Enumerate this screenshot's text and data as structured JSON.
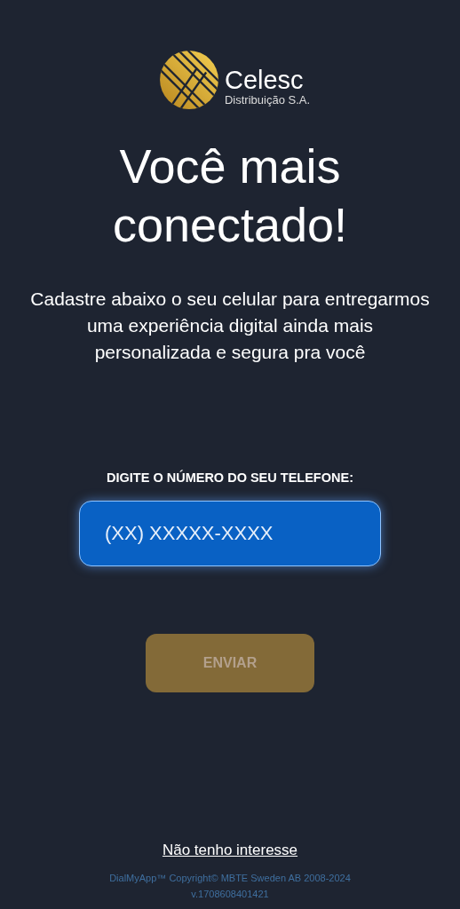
{
  "logo": {
    "name": "Celesc",
    "subtitle": "Distribuição S.A."
  },
  "title": "Você mais conectado!",
  "description": "Cadastre abaixo o seu celular para entregarmos uma experiência digital ainda mais personalizada e segura pra você",
  "phone_field": {
    "label": "DIGITE O NÚMERO DO SEU TELEFONE:",
    "placeholder": "(XX) XXXXX-XXXX"
  },
  "submit_button": {
    "label": "ENVIAR",
    "disabled": true
  },
  "decline_link": "Não tenho interesse",
  "footer": {
    "copyright": "DialMyApp™ Copyright© MBTE Sweden AB 2008-2024",
    "version": "v.1708608401421"
  }
}
